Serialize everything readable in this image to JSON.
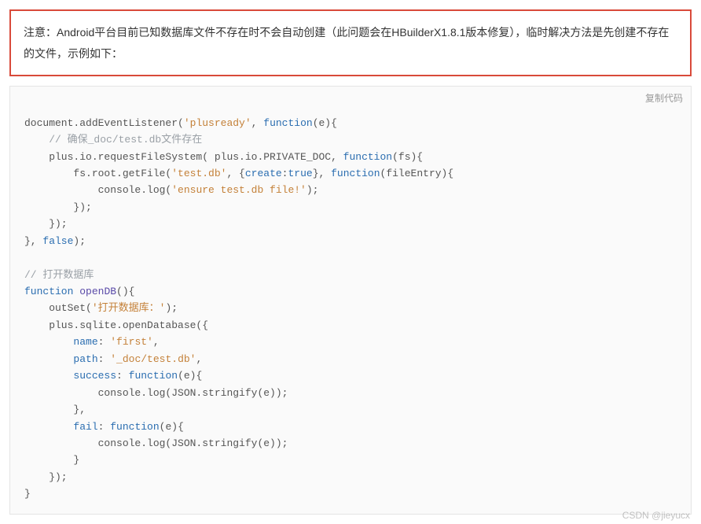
{
  "alert": {
    "text": "注意：Android平台目前已知数据库文件不存在时不会自动创建（此问题会在HBuilderX1.8.1版本修复），临时解决方法是先创建不存在的文件，示例如下："
  },
  "code": {
    "copy_label": "复制代码",
    "s_plusready": "'plusready'",
    "c_ensure": "// 确保_doc/test.db文件存在",
    "s_testdb": "'test.db'",
    "k_create": "create",
    "b_true": "true",
    "s_ensure_log": "'ensure test.db file!'",
    "b_false": "false",
    "c_open": "// 打开数据库",
    "kw_function": "function",
    "fn_openDB": "openDB",
    "s_open_title": "'打开数据库：'",
    "k_name": "name",
    "s_first": "'first'",
    "k_path": "path",
    "s_doc_test": "'_doc/test.db'",
    "k_success": "success",
    "k_fail": "fail"
  },
  "watermark": "CSDN @jieyucx"
}
